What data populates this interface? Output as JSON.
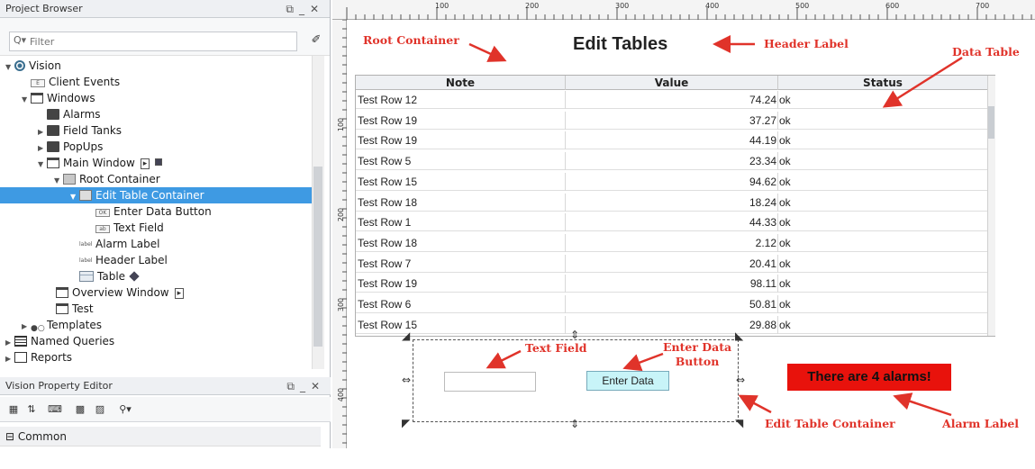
{
  "project_browser": {
    "title": "Project Browser",
    "filter_placeholder": "Filter",
    "tree": {
      "vision": "Vision",
      "client_events": "Client Events",
      "windows": "Windows",
      "alarms": "Alarms",
      "field_tanks": "Field Tanks",
      "popups": "PopUps",
      "main_window": "Main Window",
      "root_container": "Root Container",
      "edit_table_container": "Edit Table Container",
      "enter_data_button": "Enter Data Button",
      "text_field": "Text Field",
      "alarm_label": "Alarm Label",
      "header_label": "Header Label",
      "table": "Table",
      "overview_window": "Overview Window",
      "test": "Test",
      "templates": "Templates",
      "named_queries": "Named Queries",
      "reports": "Reports"
    }
  },
  "property_editor": {
    "title": "Vision Property Editor",
    "section": "Common"
  },
  "ruler": {
    "ticks": [
      "100",
      "200",
      "300",
      "400",
      "500",
      "600",
      "700"
    ],
    "vticks": [
      "100",
      "200",
      "300",
      "400"
    ]
  },
  "canvas": {
    "header_label": "Edit Tables",
    "table": {
      "columns": [
        "Note",
        "Value",
        "Status"
      ],
      "rows": [
        [
          "Test Row 12",
          "74.24",
          "ok"
        ],
        [
          "Test Row 19",
          "37.27",
          "ok"
        ],
        [
          "Test Row 19",
          "44.19",
          "ok"
        ],
        [
          "Test Row 5",
          "23.34",
          "ok"
        ],
        [
          "Test Row 15",
          "94.62",
          "ok"
        ],
        [
          "Test Row 18",
          "18.24",
          "ok"
        ],
        [
          "Test Row 1",
          "44.33",
          "ok"
        ],
        [
          "Test Row 18",
          "2.12",
          "ok"
        ],
        [
          "Test Row 7",
          "20.41",
          "ok"
        ],
        [
          "Test Row 19",
          "98.11",
          "ok"
        ],
        [
          "Test Row 6",
          "50.81",
          "ok"
        ],
        [
          "Test Row 15",
          "29.88",
          "ok"
        ]
      ]
    },
    "enter_data_button": "Enter Data",
    "alarm_label": "There are 4 alarms!"
  },
  "annotations": {
    "root_container": "Root Container",
    "header_label": "Header Label",
    "data_table": "Data Table",
    "text_field": "Text Field",
    "enter_data_button_line1": "Enter Data",
    "enter_data_button_line2": "Button",
    "edit_table_container": "Edit Table Container",
    "alarm_label": "Alarm Label"
  },
  "colors": {
    "selection": "#3e9ae3",
    "annotation": "#e0332a",
    "alarm_bg": "#e8120c",
    "button_bg": "#c8f4f8"
  }
}
